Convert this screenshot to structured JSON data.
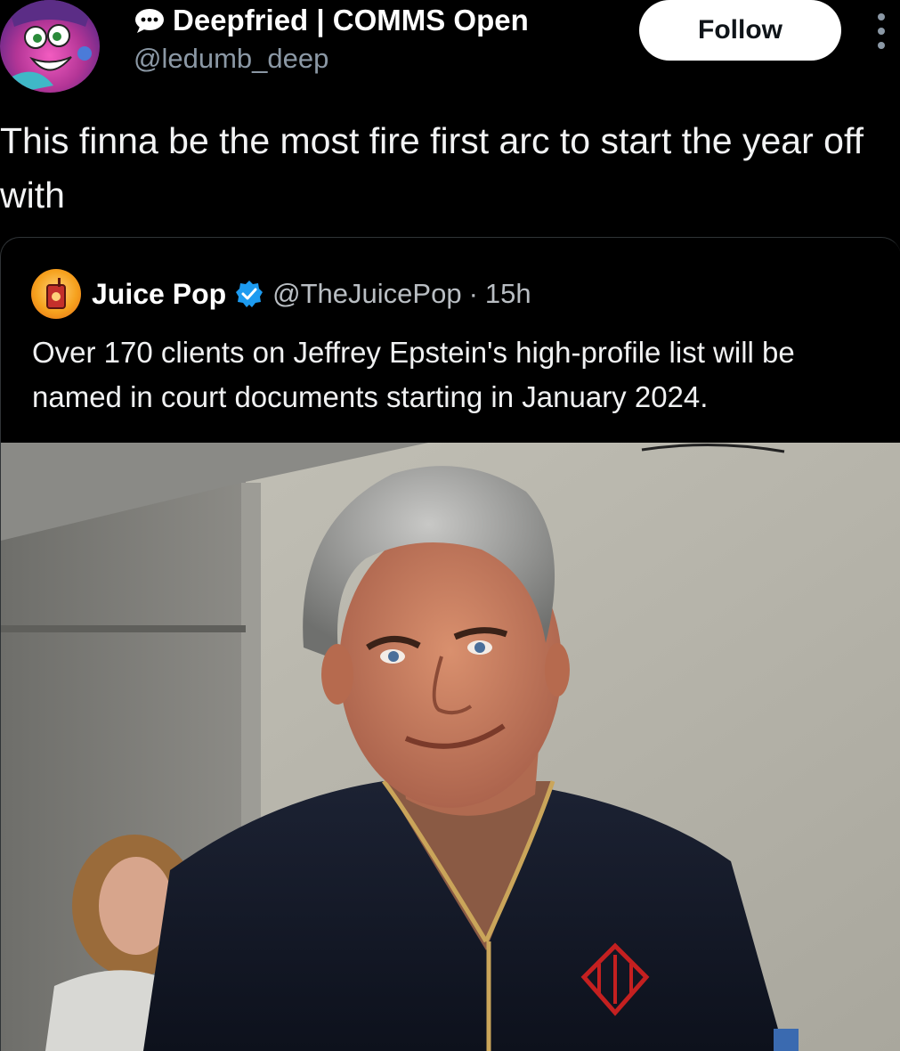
{
  "author": {
    "display_name": "Deepfried | COMMS Open",
    "handle": "@ledumb_deep",
    "avatar_icon": "cartoon-character-avatar",
    "name_prefix_icon": "speech-bubble-icon"
  },
  "follow_button": {
    "label": "Follow"
  },
  "more_icon": "vertical-ellipsis-icon",
  "tweet": {
    "text": "This finna be the most fire first arc to start the year off with"
  },
  "quoted_tweet": {
    "display_name": "Juice Pop",
    "verified": true,
    "handle": "@TheJuicePop",
    "separator": "·",
    "timestamp": "15h",
    "text": "Over 170 clients on Jeffrey Epstein's high-profile list will be named in court documents starting in January 2024.",
    "media": {
      "type": "photo",
      "subject": "man in navy zip sweater with red monogram"
    }
  },
  "colors": {
    "background": "#000000",
    "primary_text": "#e7e9ea",
    "secondary_text": "#8b98a5",
    "follow_bg": "#ffffff",
    "verified": "#1d9bf0",
    "border": "#2f3336"
  }
}
